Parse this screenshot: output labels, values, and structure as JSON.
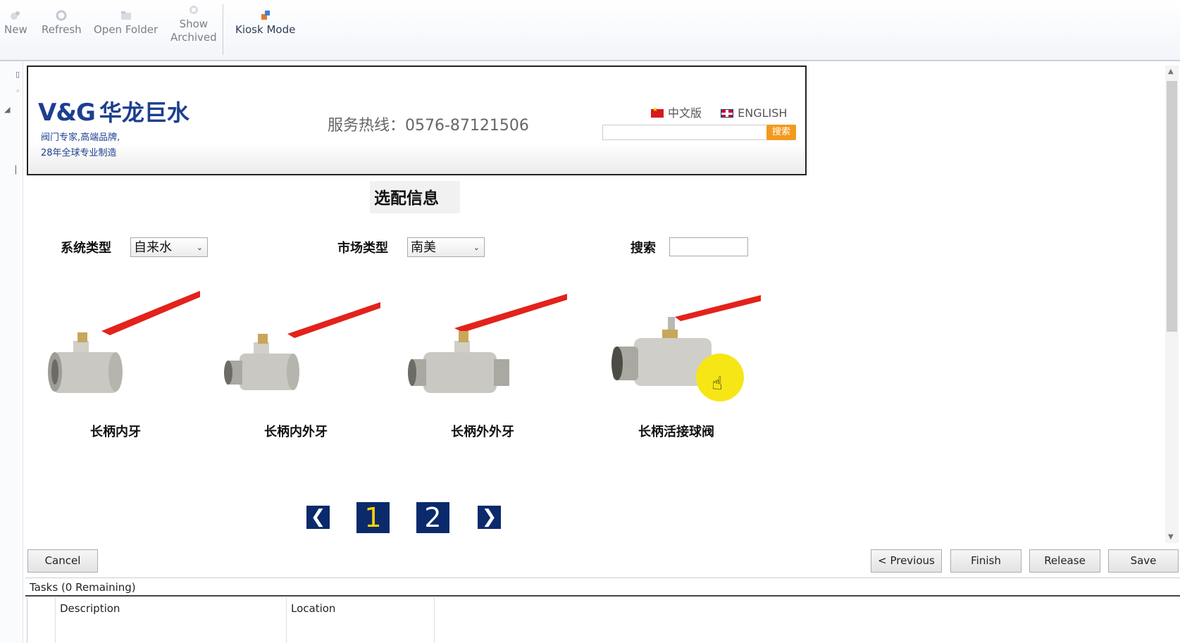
{
  "toolbar": {
    "new_label": "New",
    "refresh_label": "Refresh",
    "open_folder_label": "Open Folder",
    "show_archived_line1": "Show",
    "show_archived_line2": "Archived",
    "kiosk_label": "Kiosk Mode"
  },
  "banner": {
    "logo_mark": "V&G",
    "logo_cn": "华龙巨水",
    "slogan_line1": "阀门专家,高端品牌,",
    "slogan_line2": "28年全球专业制造",
    "hotline": "服务热线：0576-87121506",
    "lang_cn": "中文版",
    "lang_en": "ENGLISH",
    "search_button": "搜索"
  },
  "form": {
    "heading": "选配信息",
    "system_type_label": "系统类型",
    "system_type_value": "自来水",
    "market_type_label": "市场类型",
    "market_type_value": "南美",
    "search_label": "搜索",
    "search_value": ""
  },
  "products": [
    {
      "name": "长柄内牙",
      "icon": "ball-valve-female"
    },
    {
      "name": "长柄内外牙",
      "icon": "ball-valve-male-female"
    },
    {
      "name": "长柄外外牙",
      "icon": "ball-valve-male"
    },
    {
      "name": "长柄活接球阀",
      "icon": "ball-valve-union"
    }
  ],
  "pager": {
    "prev": "❮",
    "next": "❯",
    "pages": [
      "1",
      "2"
    ],
    "current_page": 1
  },
  "footer": {
    "cancel": "Cancel",
    "previous": "< Previous",
    "finish": "Finish",
    "release": "Release",
    "save": "Save"
  },
  "tasks": {
    "title": "Tasks (0 Remaining)",
    "columns": [
      "Description",
      "Location"
    ]
  },
  "colors": {
    "brand_blue": "#1c3f8f",
    "pager_bg": "#0a2a6b",
    "pager_current": "#ffd200",
    "search_btn": "#f39a1e",
    "cursor_highlight": "#f6e616",
    "valve_handle": "#e3221c"
  }
}
